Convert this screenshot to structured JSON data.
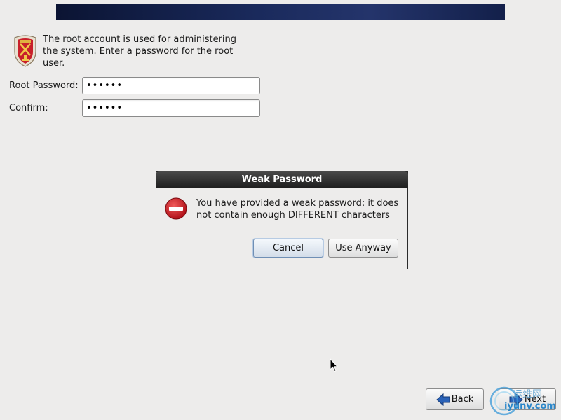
{
  "intro": {
    "text": "The root account is used for administering the system.  Enter a password for the root user."
  },
  "form": {
    "root_password_label": "Root Password:",
    "root_password_value": "••••••",
    "confirm_label": "Confirm:",
    "confirm_value": "••••••"
  },
  "dialog": {
    "title": "Weak Password",
    "message": "You have provided a weak password: it does not contain enough DIFFERENT characters",
    "cancel_label": "Cancel",
    "use_anyway_label": "Use Anyway"
  },
  "nav": {
    "back_label": "Back",
    "next_label": "Next"
  },
  "watermark": {
    "chinese": "运维网",
    "url": "iyunv.com"
  },
  "icons": {
    "intro": "shield-icon",
    "dialog": "error-icon",
    "back": "arrow-left-icon",
    "next": "arrow-right-icon"
  },
  "colors": {
    "banner": "#1a2a5c",
    "error": "#c8161d",
    "arrow": "#2a62b8"
  }
}
